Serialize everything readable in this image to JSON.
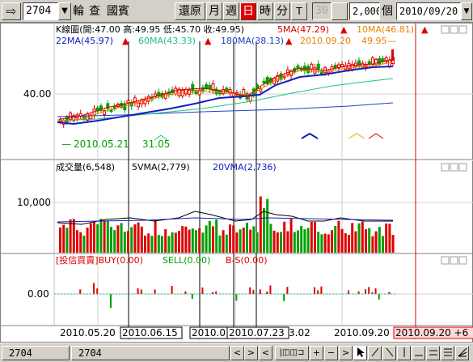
{
  "toolbar": {
    "nav_arrow": "⇨",
    "stock_code": "2704",
    "dropdown_arrow": "▼",
    "btn_lun": "輪",
    "btn_cha": "查",
    "btn_guobin": "國賓",
    "btn_restore": "還原",
    "btn_month": "月",
    "btn_week": "週",
    "btn_day": "日",
    "btn_hour": "時",
    "btn_minute": "分",
    "btn_t": "T",
    "field_30": "30",
    "field_count": "2,000",
    "count_unit": "個",
    "date_field": "2010/09/20"
  },
  "price_panel": {
    "info_line": "K線圖(開:47.00 高:49.95 低:45.70 收:49.95)",
    "ma5": "5MA(47.29)",
    "ma10": "10MA(46.81)",
    "ma22": "22MA(45.97)",
    "ma60": "60MA(43.33)",
    "ma180": "180MA(38.13)",
    "marker_text": "2010.09.20",
    "marker_value": "49.95",
    "low_marker_date": "2010.05.21",
    "low_marker_value": "31.05",
    "y_label": "40.00"
  },
  "volume_panel": {
    "title": "成交量(6,548)",
    "vma5": "5VMA(2,779)",
    "vma20": "20VMA(2,736)",
    "y_label": "10,000"
  },
  "inst_panel": {
    "title": "[投信買賣]BUY(0.00)",
    "sell": "SELL(0.00)",
    "bs": "B-S(0.00)",
    "y_label": "0.00"
  },
  "x_axis": {
    "label_1": "2010.05.20",
    "label_2": "2010.06.15",
    "label_3": "2010.0",
    "label_4": "2010.07.23",
    "label_5": "3.02",
    "label_6": "2010.09.20",
    "label_cursor": "2010.09.20 +6"
  },
  "up_arrow": "▲",
  "colors": {
    "up": "#e00000",
    "down": "#00a000",
    "ma5": "#e00000",
    "ma10": "#f08000",
    "ma22": "#1020c0",
    "ma60": "#20c080",
    "ma180": "#2040c0",
    "vma5": "#000000",
    "vma20": "#1020c0"
  },
  "bottom": {
    "tab1": "2704",
    "tab2": "2704",
    "nav_prev": "<",
    "nav_next": ">",
    "nav_left": "<",
    "zoom_label": "|◫◫⊐",
    "zoom_in": "+",
    "zoom_out": "−",
    "nav_end": ">"
  }
}
